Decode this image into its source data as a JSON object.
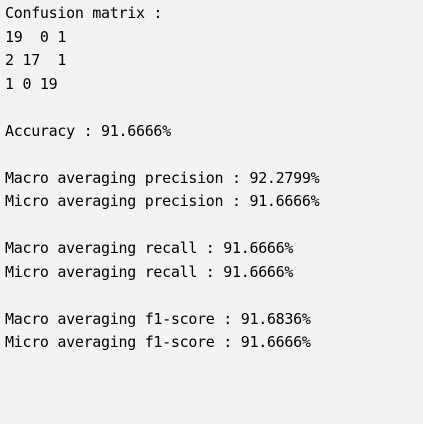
{
  "console": {
    "confusion_matrix_label": "Confusion matrix :",
    "matrix_rows": [
      "19  0 1",
      "2 17  1",
      "1 0 19"
    ],
    "accuracy": "Accuracy : 91.6666%",
    "macro_precision": "Macro averaging precision : 92.2799%",
    "micro_precision": "Micro averaging precision : 91.6666%",
    "macro_recall": "Macro averaging recall : 91.6666%",
    "micro_recall": "Micro averaging recall : 91.6666%",
    "macro_f1": "Macro averaging f1-score : 91.6836%",
    "micro_f1": "Micro averaging f1-score : 91.6666%"
  },
  "colors": {
    "background": "#f3f3f3",
    "text": "#000000"
  }
}
